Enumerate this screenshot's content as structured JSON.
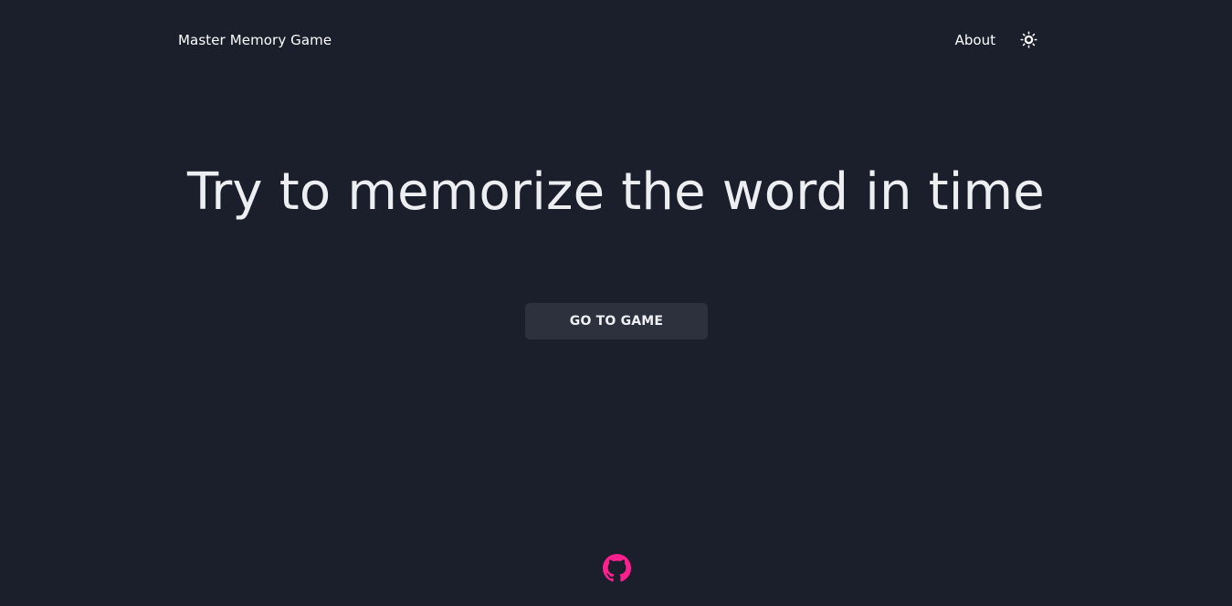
{
  "header": {
    "brand": "Master Memory Game",
    "nav_about": "About",
    "theme_icon": "sun-icon"
  },
  "hero": {
    "title": "Try to memorize the word in time",
    "cta_label": "GO TO GAME"
  },
  "footer": {
    "github_icon": "github-icon",
    "accent_color": "#ff1f8f"
  },
  "colors": {
    "background": "#1b1f2b",
    "button_background": "#2c313d",
    "text": "#eceef2"
  }
}
